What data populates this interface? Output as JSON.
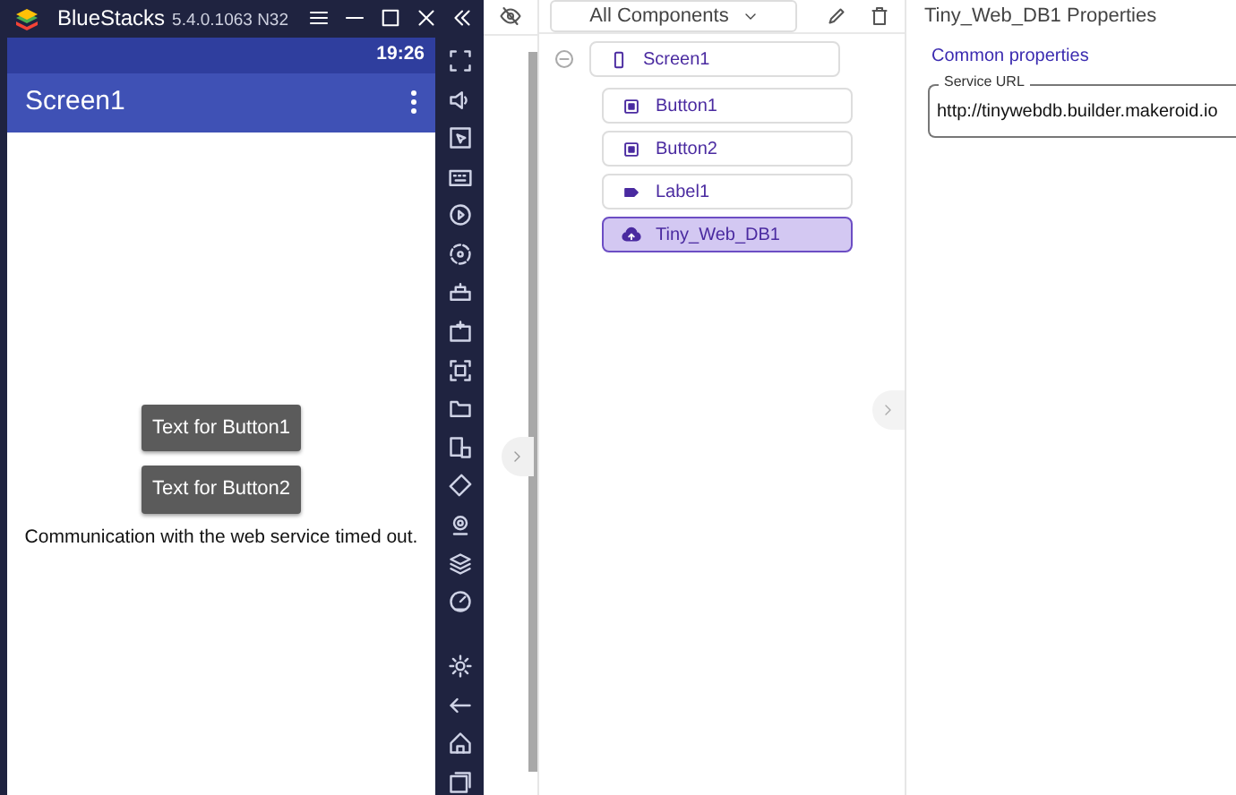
{
  "emulator": {
    "title": "BlueStacks",
    "version": "5.4.0.1063 N32",
    "clock": "19:26",
    "screen_title": "Screen1",
    "buttons": [
      "Text for Button1",
      "Text for Button2"
    ],
    "label": "Communication with the web service timed out."
  },
  "components": {
    "filter": "All Components",
    "tree": [
      {
        "name": "Screen1",
        "kind": "screen",
        "selected": false,
        "expanded": true,
        "children": [
          {
            "name": "Button1",
            "kind": "button",
            "selected": false
          },
          {
            "name": "Button2",
            "kind": "button",
            "selected": false
          },
          {
            "name": "Label1",
            "kind": "label",
            "selected": false
          },
          {
            "name": "Tiny_Web_DB1",
            "kind": "webdb",
            "selected": true
          }
        ]
      }
    ]
  },
  "properties": {
    "title": "Tiny_Web_DB1 Properties",
    "section": "Common properties",
    "fields": [
      {
        "label": "Service URL",
        "value": "http://tinywebdb.builder.makeroid.io"
      }
    ]
  }
}
